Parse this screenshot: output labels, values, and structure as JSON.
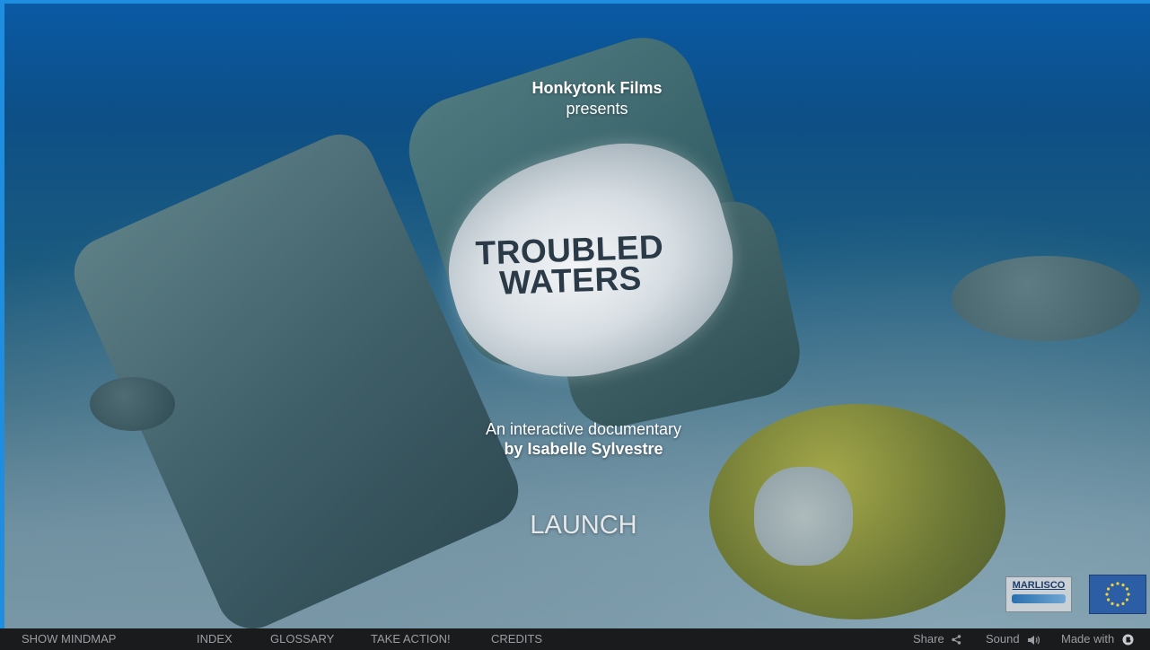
{
  "intro": {
    "studio": "Honkytonk Films",
    "presents": "presents",
    "title_line1": "TROUBLED",
    "title_line2": "WATERS",
    "subtitle": "An interactive documentary",
    "author": "by Isabelle Sylvestre",
    "launch_label": "LAUNCH"
  },
  "logos": {
    "partner": "MARLISCO"
  },
  "bottom_nav": {
    "items": [
      {
        "label": "SHOW MINDMAP"
      },
      {
        "label": "INDEX"
      },
      {
        "label": "GLOSSARY"
      },
      {
        "label": "TAKE ACTION!"
      },
      {
        "label": "CREDITS"
      }
    ],
    "share_label": "Share",
    "sound_label": "Sound",
    "made_with_label": "Made with",
    "share_icon": "share-icon",
    "sound_icon": "speaker-icon",
    "made_with_icon": "brand-icon"
  },
  "colors": {
    "accent_border": "#1f8de0",
    "bar_bg": "#1a1b1d",
    "bar_text": "#9a9ea3"
  }
}
